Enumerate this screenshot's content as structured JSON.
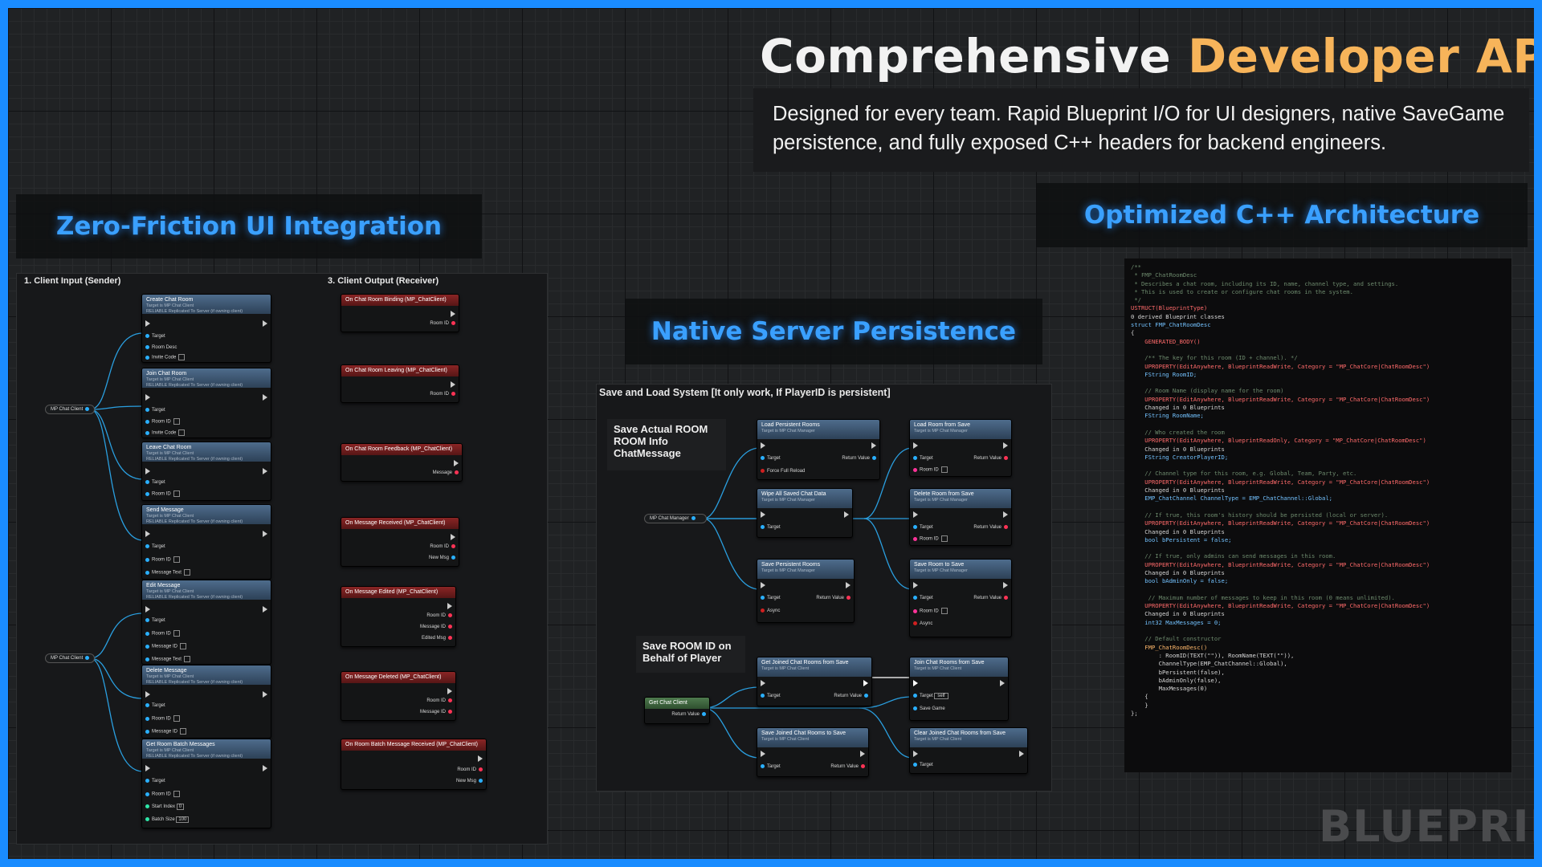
{
  "header": {
    "title_part1": "Comprehensive",
    "title_part2": "Developer API",
    "subtitle": "Designed for every team. Rapid Blueprint I/O for UI designers, native SaveGame persistence, and fully exposed C++ headers for backend engineers."
  },
  "sections": {
    "ui": "Zero-Friction UI Integration",
    "cpp": "Optimized C++ Architecture",
    "server": "Native Server Persistence"
  },
  "ui_panel": {
    "input_label": "1. Client Input (Sender)",
    "output_label": "3. Client Output (Receiver)",
    "var_node": "MP Chat Client",
    "input_nodes": [
      {
        "title": "Create Chat Room",
        "sub1": "Target is MP Chat Client",
        "sub2": "RELIABLE Replicated To Server (if owning client)",
        "pins": [
          "Target",
          "Room Desc",
          "Invite Code"
        ]
      },
      {
        "title": "Join Chat Room",
        "sub1": "Target is MP Chat Client",
        "sub2": "RELIABLE Replicated To Server (if owning client)",
        "pins": [
          "Target",
          "Room ID",
          "Invite Code"
        ]
      },
      {
        "title": "Leave Chat Room",
        "sub1": "Target is MP Chat Client",
        "sub2": "RELIABLE Replicated To Server (if owning client)",
        "pins": [
          "Target",
          "Room ID"
        ]
      },
      {
        "title": "Send Message",
        "sub1": "Target is MP Chat Client",
        "sub2": "RELIABLE Replicated To Server (if owning client)",
        "pins": [
          "Target",
          "Room ID",
          "Message Text"
        ]
      },
      {
        "title": "Edit Message",
        "sub1": "Target is MP Chat Client",
        "sub2": "RELIABLE Replicated To Server (if owning client)",
        "pins": [
          "Target",
          "Room ID",
          "Message ID",
          "Message Text"
        ]
      },
      {
        "title": "Delete Message",
        "sub1": "Target is MP Chat Client",
        "sub2": "RELIABLE Replicated To Server (if owning client)",
        "pins": [
          "Target",
          "Room ID",
          "Message ID"
        ]
      },
      {
        "title": "Get Room Batch Messages",
        "sub1": "Target is MP Chat Client",
        "sub2": "RELIABLE Replicated To Server (if owning client)",
        "pins": [
          "Target",
          "Room ID",
          "Start Index",
          "Batch Size"
        ],
        "start_index": "0",
        "batch_size": "100"
      }
    ],
    "output_nodes": [
      {
        "title": "On Chat Room Binding (MP_ChatClient)",
        "pins": [
          "Room ID"
        ]
      },
      {
        "title": "On Chat Room Leaving (MP_ChatClient)",
        "pins": [
          "Room ID"
        ]
      },
      {
        "title": "On Chat Room Feedback (MP_ChatClient)",
        "pins": [
          "Message"
        ]
      },
      {
        "title": "On Message Received (MP_ChatClient)",
        "pins": [
          "Room ID",
          "New Msg"
        ]
      },
      {
        "title": "On Message Edited (MP_ChatClient)",
        "pins": [
          "Room ID",
          "Message ID",
          "Edited Msg"
        ]
      },
      {
        "title": "On Message Deleted (MP_ChatClient)",
        "pins": [
          "Room ID",
          "Message ID"
        ]
      },
      {
        "title": "On Room Batch Message Received (MP_ChatClient)",
        "pins": [
          "Room ID",
          "New Msg"
        ]
      }
    ]
  },
  "server_panel": {
    "label": "Save and Load System [It only work, If PlayerID is persistent]",
    "comment1": "Save Actual ROOM ROOM Info ChatMessage",
    "comment2": "Save ROOM ID on Behalf of Player",
    "manager_var": "MP Chat Manager",
    "get_client": "Get Chat Client",
    "return_value": "Return Value",
    "nodes": [
      {
        "title": "Load Persistent Rooms",
        "sub": "Target is MP Chat Manager",
        "pins": [
          "Target",
          "Force Full Reload"
        ],
        "ret": "Return Value"
      },
      {
        "title": "Wipe All Saved Chat Data",
        "sub": "Target is MP Chat Manager",
        "pins": [
          "Target"
        ],
        "ret": ""
      },
      {
        "title": "Save Persistent Rooms",
        "sub": "Target is MP Chat Manager",
        "pins": [
          "Target",
          "Async"
        ],
        "ret": "Return Value"
      },
      {
        "title": "Load Room from Save",
        "sub": "Target is MP Chat Manager",
        "pins": [
          "Target",
          "Room ID"
        ],
        "ret": "Return Value"
      },
      {
        "title": "Delete Room from Save",
        "sub": "Target is MP Chat Manager",
        "pins": [
          "Target",
          "Room ID"
        ],
        "ret": "Return Value"
      },
      {
        "title": "Save Room to Save",
        "sub": "Target is MP Chat Manager",
        "pins": [
          "Target",
          "Room ID",
          "Async"
        ],
        "ret": "Return Value"
      },
      {
        "title": "Get Joined Chat Rooms from Save",
        "sub": "Target is MP Chat Client",
        "pins": [
          "Target"
        ],
        "ret": "Return Value"
      },
      {
        "title": "Save Joined Chat Rooms to Save",
        "sub": "Target is MP Chat Client",
        "pins": [
          "Target"
        ],
        "ret": "Return Value"
      },
      {
        "title": "Join Chat Rooms from Save",
        "sub": "Target is MP Chat Client",
        "pins": [
          "Target",
          "Save Game"
        ],
        "ret": "",
        "self_tag": "self"
      },
      {
        "title": "Clear Joined Chat Rooms from Save",
        "sub": "Target is MP Chat Client",
        "pins": [
          "Target"
        ],
        "ret": ""
      }
    ]
  },
  "code": {
    "lines": [
      "/**",
      " * FMP_ChatRoomDesc",
      " * Describes a chat room, including its ID, name, channel type, and settings.",
      " * This is used to create or configure chat rooms in the system.",
      " */",
      "USTRUCT(BlueprintType)",
      "0 derived Blueprint classes",
      "struct FMP_ChatRoomDesc",
      "{",
      "    GENERATED_BODY()",
      "",
      "    /** The key for this room (ID + channel). */",
      "    UPROPERTY(EditAnywhere, BlueprintReadWrite, Category = \"MP_ChatCore|ChatRoomDesc\")",
      "    FString RoomID;",
      "",
      "    // Room Name (display name for the room)",
      "    UPROPERTY(EditAnywhere, BlueprintReadWrite, Category = \"MP_ChatCore|ChatRoomDesc\")",
      "    Changed in 0 Blueprints",
      "    FString RoomName;",
      "",
      "    // Who created the room",
      "    UPROPERTY(EditAnywhere, BlueprintReadOnly, Category = \"MP_ChatCore|ChatRoomDesc\")",
      "    Changed in 0 Blueprints",
      "    FString CreatorPlayerID;",
      "",
      "    // Channel type for this room, e.g. Global, Team, Party, etc.",
      "    UPROPERTY(EditAnywhere, BlueprintReadWrite, Category = \"MP_ChatCore|ChatRoomDesc\")",
      "    Changed in 0 Blueprints",
      "    EMP_ChatChannel ChannelType = EMP_ChatChannel::Global;",
      "",
      "    // If true, this room's history should be persisted (local or server).",
      "    UPROPERTY(EditAnywhere, BlueprintReadWrite, Category = \"MP_ChatCore|ChatRoomDesc\")",
      "    Changed in 0 Blueprints",
      "    bool bPersistent = false;",
      "",
      "    // If true, only admins can send messages in this room.",
      "    UPROPERTY(EditAnywhere, BlueprintReadWrite, Category = \"MP_ChatCore|ChatRoomDesc\")",
      "    Changed in 0 Blueprints",
      "    bool bAdminOnly = false;",
      "",
      "     // Maximum number of messages to keep in this room (0 means unlimited).",
      "    UPROPERTY(EditAnywhere, BlueprintReadWrite, Category = \"MP_ChatCore|ChatRoomDesc\")",
      "    Changed in 0 Blueprints",
      "    int32 MaxMessages = 0;",
      "",
      "    // Default constructor",
      "    FMP_ChatRoomDesc()",
      "        : RoomID(TEXT(\"\")), RoomName(TEXT(\"\")),",
      "        ChannelType(EMP_ChatChannel::Global),",
      "        bPersistent(false),",
      "        bAdminOnly(false),",
      "        MaxMessages(0)",
      "    {",
      "    }",
      "};"
    ]
  },
  "watermark": "BLUEPRINT",
  "colors": {
    "frame": "#1a8cff",
    "title_orange": "#f7b45a",
    "section_blue": "#3aa0ff",
    "pin_blue": "#2ab0ff",
    "event_red": "#8a2525"
  }
}
